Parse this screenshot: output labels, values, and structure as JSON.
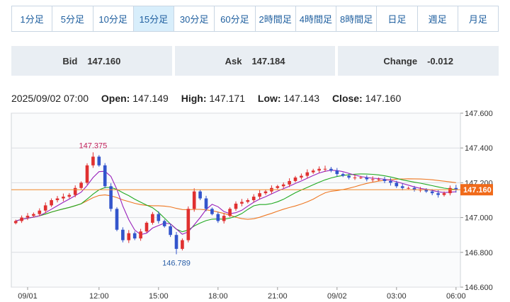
{
  "tabs": [
    {
      "label": "1分足"
    },
    {
      "label": "5分足"
    },
    {
      "label": "10分足"
    },
    {
      "label": "15分足",
      "active": true
    },
    {
      "label": "30分足"
    },
    {
      "label": "60分足"
    },
    {
      "label": "2時間足"
    },
    {
      "label": "4時間足"
    },
    {
      "label": "8時間足"
    },
    {
      "label": "日足"
    },
    {
      "label": "週足"
    },
    {
      "label": "月足"
    }
  ],
  "quote": {
    "bid_label": "Bid",
    "bid_value": "147.160",
    "ask_label": "Ask",
    "ask_value": "147.184",
    "change_label": "Change",
    "change_value": "-0.012"
  },
  "ohlc": {
    "datetime": "2025/09/02 07:00",
    "open_label": "Open:",
    "open": "147.149",
    "high_label": "High:",
    "high": "147.171",
    "low_label": "Low:",
    "low": "147.143",
    "close_label": "Close:",
    "close": "147.160"
  },
  "chart_data": {
    "type": "candlestick",
    "ylim": [
      146.6,
      147.6
    ],
    "y_ticks": [
      "147.600",
      "147.400",
      "147.200",
      "147.000",
      "146.800",
      "146.600"
    ],
    "x_labels": [
      "09/01",
      "12:00",
      "15:00",
      "18:00",
      "21:00",
      "09/02",
      "03:00",
      "06:00"
    ],
    "x_label_candle_index": [
      2,
      14,
      24,
      34,
      44,
      54,
      64,
      74
    ],
    "annotations": [
      {
        "text": "147.375",
        "price": 147.375,
        "candle_index": 13
      },
      {
        "text": "146.789",
        "price": 146.789,
        "candle_index": 27
      }
    ],
    "current_price": {
      "text": "147.160",
      "price": 147.16
    },
    "colors": {
      "up": "#e03030",
      "down": "#3355cc",
      "ma_short": "#9922bb",
      "ma_mid": "#22aa22",
      "ma_long": "#ee7722",
      "price_line": "#f08a2a"
    },
    "moving_averages": {
      "short": 5,
      "mid": 12,
      "long": 24
    },
    "closes": [
      146.98,
      147.0,
      147.01,
      147.02,
      147.04,
      147.07,
      147.1,
      147.11,
      147.12,
      147.13,
      147.17,
      147.2,
      147.3,
      147.35,
      147.3,
      147.18,
      147.05,
      146.93,
      146.87,
      146.91,
      146.88,
      146.92,
      146.97,
      147.02,
      146.98,
      146.95,
      146.9,
      146.82,
      146.87,
      147.05,
      147.15,
      147.11,
      147.05,
      147.02,
      146.98,
      147.01,
      147.05,
      147.08,
      147.09,
      147.1,
      147.12,
      147.14,
      147.15,
      147.17,
      147.18,
      147.19,
      147.21,
      147.23,
      147.24,
      147.26,
      147.27,
      147.28,
      147.28,
      147.27,
      147.25,
      147.24,
      147.23,
      147.23,
      147.23,
      147.22,
      147.22,
      147.22,
      147.21,
      147.2,
      147.18,
      147.17,
      147.17,
      147.16,
      147.16,
      147.15,
      147.14,
      147.13,
      147.14,
      147.17,
      147.16
    ]
  }
}
